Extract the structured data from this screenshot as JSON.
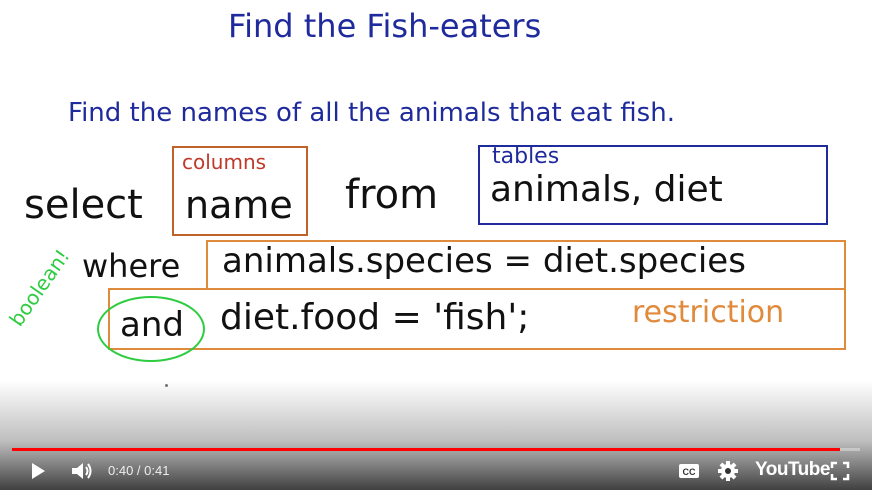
{
  "slide": {
    "title": "Find the Fish-eaters",
    "subtitle": "Find the names of all the animals that eat fish.",
    "columns_label": "columns",
    "tables_label": "tables",
    "select_kw": "select",
    "name_word": "name",
    "from_kw": "from",
    "tables_value": "animals, diet",
    "where_kw": "where",
    "condition1": "animals.species = diet.species",
    "and_kw": "and",
    "condition2": "diet.food = 'fish';",
    "restriction_label": "restriction",
    "boolean_label": "boolean!"
  },
  "player": {
    "current_time": "0:40",
    "separator": " / ",
    "duration": "0:41",
    "progress": 0.976,
    "brand": "YouTube",
    "accent_color": "#ff0000",
    "icons": [
      "play-icon",
      "volume-icon",
      "captions-icon",
      "settings-icon",
      "fullscreen-icon"
    ]
  }
}
